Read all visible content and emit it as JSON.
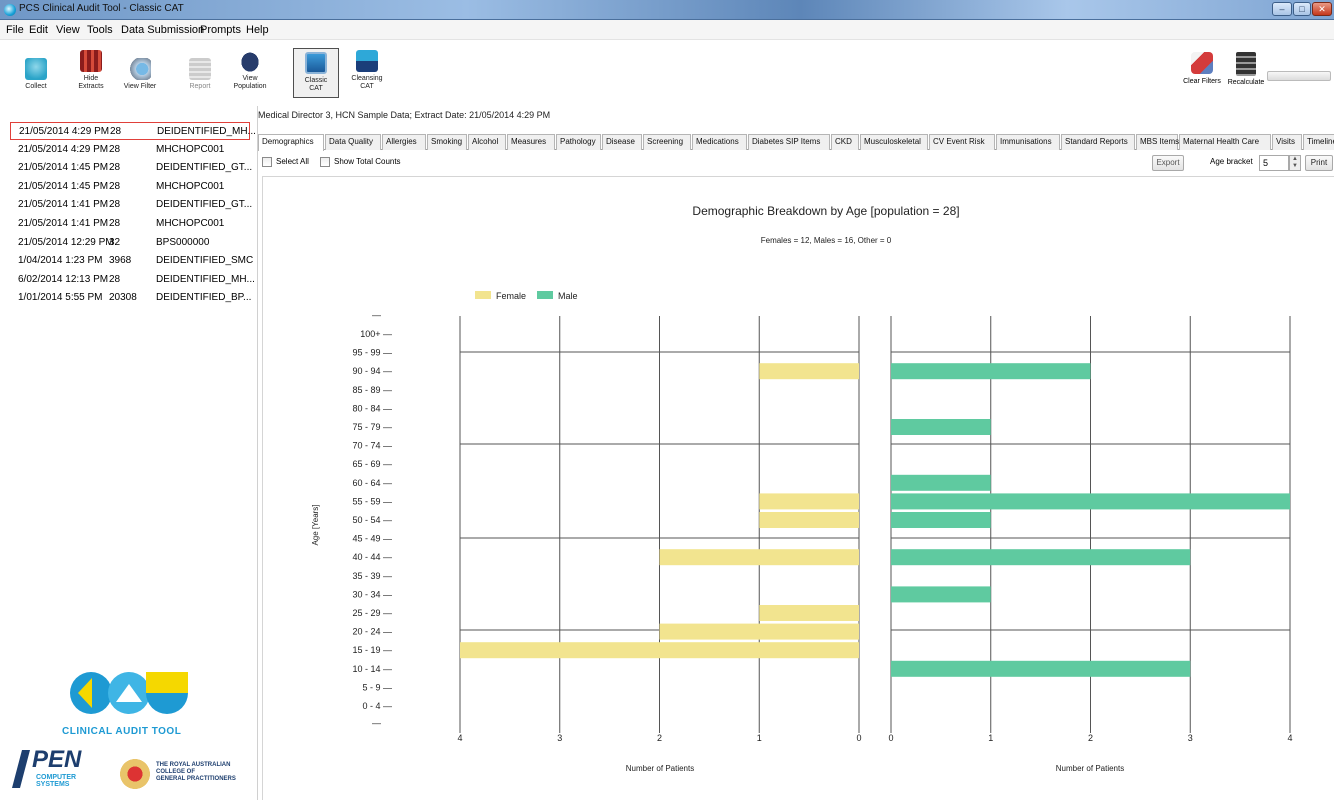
{
  "window": {
    "title": "PCS Clinical Audit Tool - Classic CAT",
    "controls": [
      "–",
      "□",
      "✕"
    ]
  },
  "menu": [
    "File",
    "Edit",
    "View",
    "Tools",
    "Data Submission",
    "Prompts",
    "Help"
  ],
  "toolbar": {
    "collect": "Collect",
    "hide_extracts": "Hide\nExtracts",
    "view_filter": "View Filter",
    "report": "Report",
    "view_population": "View\nPopulation",
    "classic_cat": "Classic\nCAT",
    "cleansing_cat": "Cleansing\nCAT",
    "clear_filters": "Clear Filters",
    "recalculate": "Recalculate"
  },
  "extracts": [
    {
      "date": "21/05/2014 4:29 PM",
      "count": "28",
      "name": "DEIDENTIFIED_MH..."
    },
    {
      "date": "21/05/2014 4:29 PM",
      "count": "28",
      "name": "MHCHOPC001"
    },
    {
      "date": "21/05/2014 1:45 PM",
      "count": "28",
      "name": "DEIDENTIFIED_GT..."
    },
    {
      "date": "21/05/2014 1:45 PM",
      "count": "28",
      "name": "MHCHOPC001"
    },
    {
      "date": "21/05/2014 1:41 PM",
      "count": "28",
      "name": "DEIDENTIFIED_GT..."
    },
    {
      "date": "21/05/2014 1:41 PM",
      "count": "28",
      "name": "MHCHOPC001"
    },
    {
      "date": "21/05/2014 12:29 PM",
      "count": "32",
      "name": "BPS000000"
    },
    {
      "date": "1/04/2014 1:23 PM",
      "count": "3968",
      "name": "DEIDENTIFIED_SMC"
    },
    {
      "date": "6/02/2014 12:13 PM",
      "count": "28",
      "name": "DEIDENTIFIED_MH..."
    },
    {
      "date": "1/01/2014 5:55 PM",
      "count": "20308",
      "name": "DEIDENTIFIED_BP..."
    }
  ],
  "logos": {
    "cat_title": "CLINICAL AUDIT TOOL",
    "pen": "PEN",
    "pen_sub": "COMPUTER\nSYSTEMS",
    "racgp": "THE ROYAL AUSTRALIAN\nCOLLEGE OF\nGENERAL PRACTITIONERS"
  },
  "info_line": "Medical Director 3, HCN Sample Data; Extract Date: 21/05/2014 4:29 PM",
  "tabs": [
    "Demographics",
    "Data Quality",
    "Allergies",
    "Smoking",
    "Alcohol",
    "Measures",
    "Pathology",
    "Disease",
    "Screening",
    "Medications",
    "Diabetes SIP Items",
    "CKD",
    "Musculoskeletal",
    "CV Event Risk",
    "Immunisations",
    "Standard Reports",
    "MBS Items",
    "Maternal Health Care",
    "Visits",
    "Timeline"
  ],
  "controls": {
    "select_all": "Select All",
    "show_total_counts": "Show Total Counts",
    "export": "Export",
    "age_bracket_label": "Age bracket",
    "age_bracket_value": "5",
    "print": "Print"
  },
  "colors": {
    "female": "#f2e48f",
    "male": "#5fcaa0",
    "selected_border": "#e0403a"
  },
  "chart_data": {
    "type": "bar",
    "title": "Demographic Breakdown by Age [population = 28]",
    "subtitle": "Females = 12, Males = 16, Other = 0",
    "ylabel": "Age [Years]",
    "xlabel": "Number of Patients",
    "legend": [
      "Female",
      "Male"
    ],
    "legend_position": "top-left",
    "categories": [
      "100+",
      "95 - 99",
      "90 - 94",
      "85 - 89",
      "80 - 84",
      "75 - 79",
      "70 - 74",
      "65 - 69",
      "60 - 64",
      "55 - 59",
      "50 - 54",
      "45 - 49",
      "40 - 44",
      "35 - 39",
      "30 - 34",
      "25 - 29",
      "20 - 24",
      "15 - 19",
      "10 - 14",
      "5 - 9",
      "0 - 4"
    ],
    "series": [
      {
        "name": "Female",
        "values": [
          0,
          0,
          1,
          0,
          0,
          0,
          0,
          0,
          0,
          1,
          1,
          0,
          2,
          0,
          0,
          1,
          2,
          4,
          0,
          0,
          0
        ]
      },
      {
        "name": "Male",
        "values": [
          0,
          0,
          2,
          0,
          0,
          1,
          0,
          0,
          1,
          4,
          1,
          0,
          3,
          0,
          1,
          0,
          0,
          0,
          3,
          0,
          0
        ]
      }
    ],
    "xlim": [
      0,
      4
    ],
    "female_ticks": [
      "4",
      "3",
      "2",
      "1",
      "0"
    ],
    "male_ticks": [
      "0",
      "1",
      "2",
      "3",
      "4"
    ],
    "grid": true
  }
}
